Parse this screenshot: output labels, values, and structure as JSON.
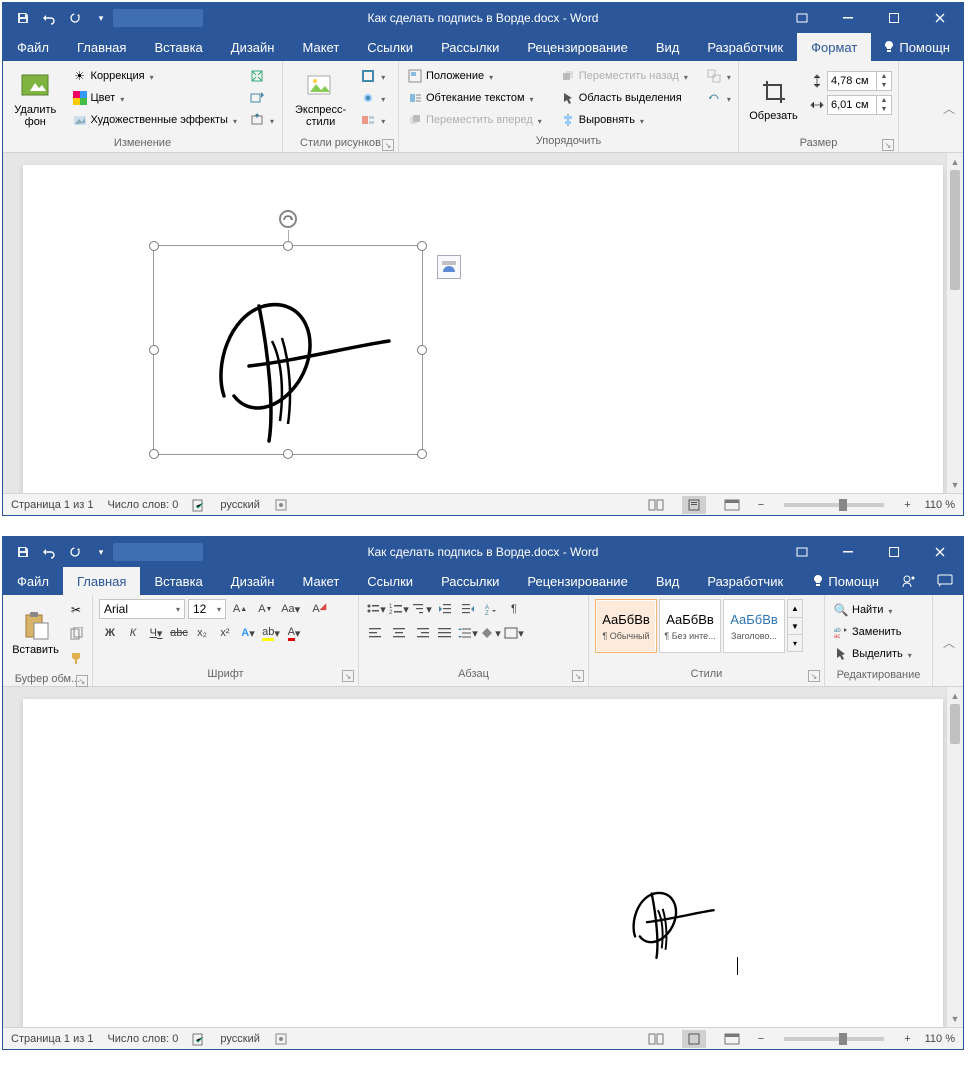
{
  "top": {
    "title": "Как сделать подпись в Ворде.docx - Word",
    "tabs": [
      "Файл",
      "Главная",
      "Вставка",
      "Дизайн",
      "Макет",
      "Ссылки",
      "Рассылки",
      "Рецензирование",
      "Вид",
      "Разработчик",
      "Формат"
    ],
    "active_tab": "Формат",
    "help": "Помощн",
    "ribbon": {
      "group1": {
        "label": "Изменение",
        "remove_bg": "Удалить\nфон",
        "corrections": "Коррекция",
        "color": "Цвет",
        "effects": "Художественные эффекты"
      },
      "group2": {
        "label": "Стили рисунков",
        "express": "Экспресс-\nстили"
      },
      "group3": {
        "label": "Упорядочить",
        "position": "Положение",
        "wrap": "Обтекание текстом",
        "forward": "Переместить вперед",
        "backward": "Переместить назад",
        "selection": "Область выделения",
        "align": "Выровнять"
      },
      "group4": {
        "label": "Размер",
        "crop": "Обрезать",
        "height": "4,78 см",
        "width": "6,01 см"
      }
    },
    "status": {
      "page": "Страница 1 из 1",
      "words": "Число слов: 0",
      "lang": "русский",
      "zoom": "110 %"
    }
  },
  "bottom": {
    "title": "Как сделать подпись в Ворде.docx - Word",
    "tabs": [
      "Файл",
      "Главная",
      "Вставка",
      "Дизайн",
      "Макет",
      "Ссылки",
      "Рассылки",
      "Рецензирование",
      "Вид",
      "Разработчик"
    ],
    "active_tab": "Главная",
    "help": "Помощн",
    "ribbon": {
      "clipboard": {
        "label": "Буфер обм...",
        "paste": "Вставить"
      },
      "font": {
        "label": "Шрифт",
        "name": "Arial",
        "size": "12",
        "bold": "Ж",
        "italic": "К",
        "underline": "Ч",
        "strike": "abc",
        "sub": "x₂",
        "sup": "x²",
        "aa": "Aa"
      },
      "para": {
        "label": "Абзац"
      },
      "styles": {
        "label": "Стили",
        "preview": "АаБбВв",
        "items": [
          "¶ Обычный",
          "¶ Без инте...",
          "Заголово..."
        ]
      },
      "edit": {
        "label": "Редактирование",
        "find": "Найти",
        "replace": "Заменить",
        "select": "Выделить"
      }
    },
    "status": {
      "page": "Страница 1 из 1",
      "words": "Число слов: 0",
      "lang": "русский",
      "zoom": "110 %"
    }
  }
}
